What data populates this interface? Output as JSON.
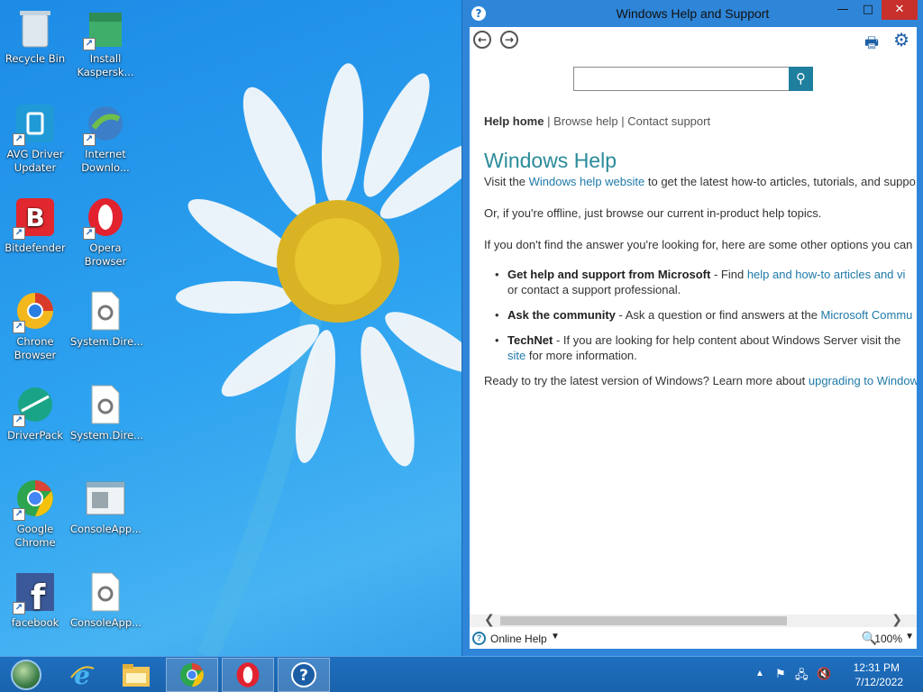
{
  "desktop": {
    "icons": [
      {
        "label": "Recycle Bin"
      },
      {
        "label": "Install Kaspersk..."
      },
      {
        "label": "AVG Driver Updater"
      },
      {
        "label": "Internet Downlo..."
      },
      {
        "label": "Bitdefender"
      },
      {
        "label": "Opera Browser"
      },
      {
        "label": "Chrone Browser"
      },
      {
        "label": "System.Dire..."
      },
      {
        "label": "DriverPack"
      },
      {
        "label": "System.Dire..."
      },
      {
        "label": "Google Chrome"
      },
      {
        "label": "ConsoleApp..."
      },
      {
        "label": "facebook"
      },
      {
        "label": "ConsoleApp..."
      }
    ]
  },
  "help_window": {
    "title": "Windows Help and Support",
    "title_icon": "?",
    "buttons": {
      "minimize": "▭",
      "maximize": "▭",
      "close": "✕"
    },
    "search": {
      "value": "",
      "placeholder": ""
    },
    "nav": {
      "home": "Help home",
      "separator": "|",
      "browse": "Browse help",
      "contact": "Contact support"
    },
    "page_title": "Windows Help",
    "intro": {
      "before": "Visit the ",
      "link": "Windows help website",
      "after": " to get the latest how-to articles, tutorials, and suppo"
    },
    "offline": "Or, if you're offline, just browse our current in-product help topics.",
    "options_intro": "If you don't find the answer you're looking for, here are some other options you can",
    "options": [
      {
        "title": "Get help and support from Microsoft",
        "text_before": " - Find ",
        "link": "help and how-to articles and vi",
        "text_after": "",
        "line2": "or contact a support professional."
      },
      {
        "title": "Ask the community",
        "text_before": " - Ask a question or find answers at the ",
        "link": "Microsoft Commu",
        "text_after": "",
        "line2": ""
      },
      {
        "title": "TechNet",
        "text_before": " - If you are looking for help content about Windows Server visit the ",
        "link": "",
        "text_after": "",
        "line2_link": "site",
        "line2": " for more information."
      }
    ],
    "closing": {
      "before": "Ready to try the latest version of Windows? Learn more about ",
      "link": "upgrading to Window"
    },
    "statusbar": {
      "online_help": "Online Help",
      "zoom": "100%"
    }
  },
  "taskbar": {
    "clock_time": "12:31 PM",
    "clock_date": "7/12/2022"
  }
}
